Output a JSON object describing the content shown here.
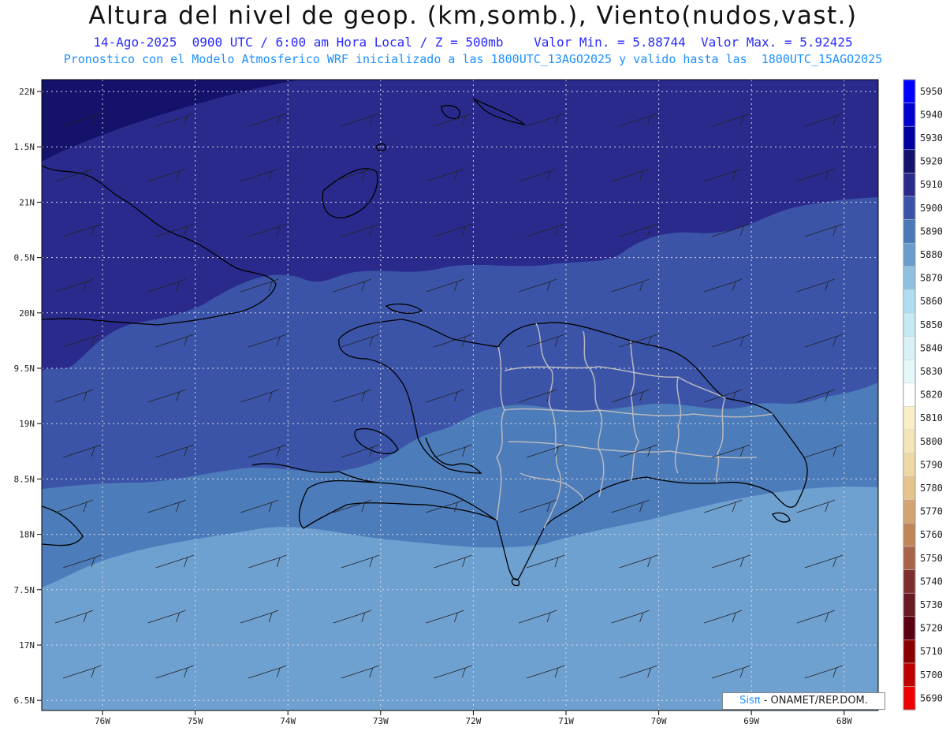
{
  "header": {
    "title": "Altura del nivel de geop. (km,somb.), Viento(nudos,vast.)",
    "subtitle1": "14-Ago-2025  0900 UTC / 6:00 am Hora Local / Z = 500mb    Valor Min. = 5.88744  Valor Max. = 5.92425",
    "subtitle2": "Pronostico con el Modelo Atmosferico WRF inicializado a las 1800UTC_13AGO2025 y valido hasta las  1800UTC_15AGO2025"
  },
  "axes": {
    "lat_labels": [
      "22N",
      "1.5N",
      "21N",
      "0.5N",
      "20N",
      "9.5N",
      "19N",
      "8.5N",
      "18N",
      "7.5N",
      "17N",
      "6.5N"
    ],
    "lon_labels": [
      "76W",
      "75W",
      "74W",
      "73W",
      "72W",
      "71W",
      "70W",
      "69W",
      "68W"
    ]
  },
  "colorbar": {
    "levels": [
      "5950",
      "5940",
      "5930",
      "5920",
      "5910",
      "5900",
      "5890",
      "5880",
      "5870",
      "5860",
      "5850",
      "5840",
      "5830",
      "5820",
      "5810",
      "5800",
      "5790",
      "5780",
      "5770",
      "5760",
      "5750",
      "5740",
      "5730",
      "5720",
      "5710",
      "5700",
      "5690"
    ],
    "colors": [
      "#0000ff",
      "#0000d0",
      "#0000a0",
      "#14146e",
      "#2a2a8a",
      "#3a52a8",
      "#4a78b8",
      "#6a9ccc",
      "#90c0e0",
      "#b0def0",
      "#c6eaf4",
      "#d8f2f8",
      "#e4f8fa",
      "#ffffff",
      "#faf0c8",
      "#f4e6b8",
      "#eed8a6",
      "#e6c48e",
      "#d4a470",
      "#c08658",
      "#a8644a",
      "#7e2e2e",
      "#6a1a22",
      "#5a0010",
      "#8a0000",
      "#c00000",
      "#ee0000"
    ]
  },
  "field_colors": {
    "f5920": "#14126a",
    "f5910": "#2a2a8c",
    "f5900": "#3b54a8",
    "f5890": "#4c7cba",
    "f5880": "#6ea0d0"
  },
  "credit": {
    "logo": "Sisπ",
    "text": "- ONAMET/REP.DOM."
  }
}
